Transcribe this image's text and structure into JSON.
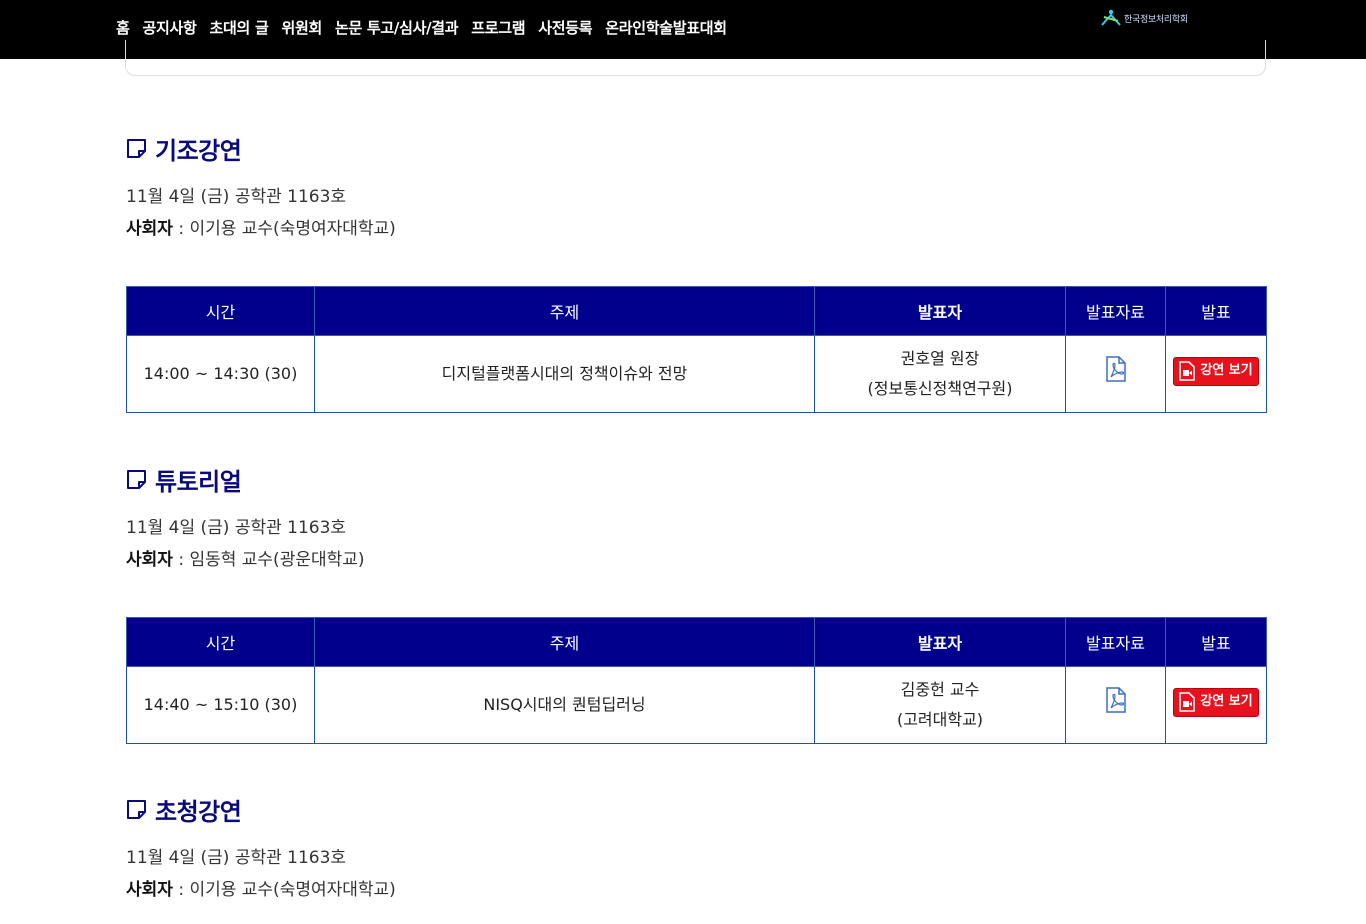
{
  "nav": {
    "items": [
      "홈",
      "공지사항",
      "초대의 글",
      "위원회",
      "논문 투고/심사/결과",
      "프로그램",
      "사전등록",
      "온라인학술발표대회"
    ],
    "logo_text": "한국정보처리학회"
  },
  "sections": [
    {
      "title": "기조강연",
      "date": "11월 4일 (금) 공학관 1163호",
      "host_label": "사회자",
      "host_value": " : 이기용 교수(숙명여자대학교)",
      "table": {
        "headers": [
          "시간",
          "주제",
          "발표자",
          "발표자료",
          "발표"
        ],
        "row": {
          "time": "14:00 ~ 14:30 (30)",
          "topic": "디지털플랫폼시대의 정책이슈와 전망",
          "speaker_name": "권호열 원장",
          "speaker_org": "(정보통신정책연구원)",
          "material_icon": "pdf-icon",
          "watch_label": "강연 보기"
        }
      }
    },
    {
      "title": "튜토리얼",
      "date": "11월 4일 (금) 공학관 1163호",
      "host_label": "사회자",
      "host_value": " : 임동혁 교수(광운대학교)",
      "table": {
        "headers": [
          "시간",
          "주제",
          "발표자",
          "발표자료",
          "발표"
        ],
        "row": {
          "time": "14:40 ~ 15:10 (30)",
          "topic": "NISQ시대의 퀀텀딥러닝",
          "speaker_name": "김중헌 교수",
          "speaker_org": "(고려대학교)",
          "material_icon": "pdf-icon",
          "watch_label": "강연 보기"
        }
      }
    },
    {
      "title": "초청강연",
      "date": "11월 4일 (금) 공학관 1163호",
      "host_label": "사회자",
      "host_value": " : 이기용 교수(숙명여자대학교)"
    }
  ],
  "colors": {
    "topbar": "#000000",
    "heading": "#0a0a7c",
    "table_header": "#00008c",
    "watch_button": "#e8121f"
  }
}
